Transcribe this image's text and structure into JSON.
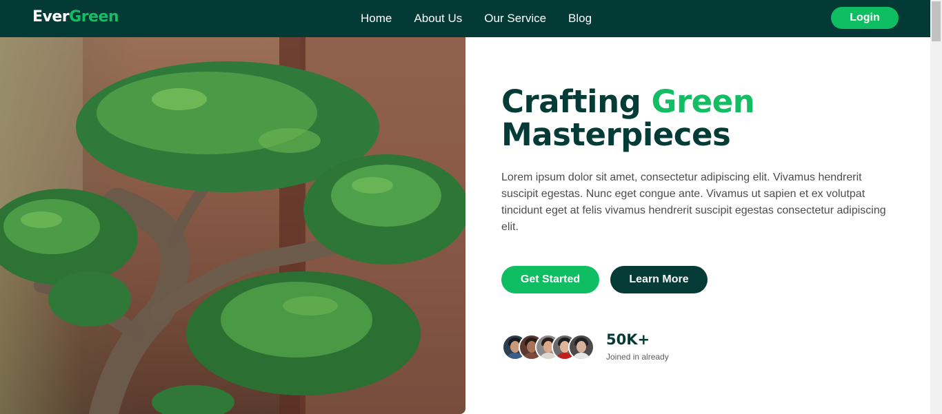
{
  "brand": {
    "part1": "Ever",
    "part2": "Green"
  },
  "nav": {
    "items": [
      {
        "label": "Home"
      },
      {
        "label": "About Us"
      },
      {
        "label": "Our Service"
      },
      {
        "label": "Blog"
      }
    ],
    "login_label": "Login"
  },
  "hero": {
    "title_part1": "Crafting ",
    "title_highlight": "Green",
    "title_part2": "Masterpieces",
    "description": "Lorem ipsum dolor sit amet, consectetur adipiscing elit. Vivamus hendrerit suscipit egestas. Nunc eget congue ante. Vivamus ut sapien et ex volutpat tincidunt eget at felis vivamus hendrerit suscipit egestas consectetur adipiscing elit.",
    "primary_button": "Get Started",
    "secondary_button": "Learn More",
    "image_icon": "bonsai-tree-photo"
  },
  "stats": {
    "count": "50K+",
    "label": "Joined in already"
  },
  "colors": {
    "brand_dark": "#053b36",
    "brand_green": "#12bd63",
    "nav_bg": "#043a35"
  }
}
